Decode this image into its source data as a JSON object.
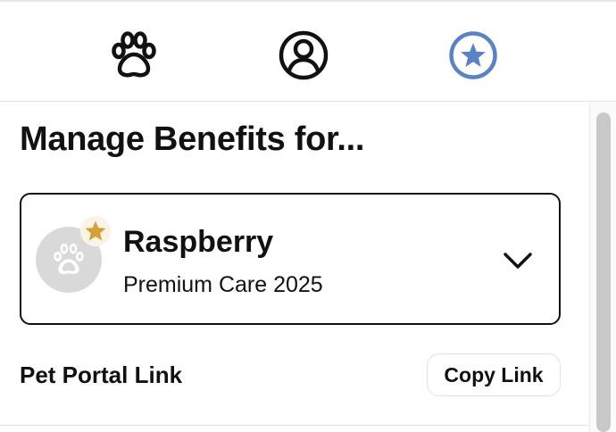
{
  "nav": {
    "items": [
      {
        "icon": "paw-icon",
        "label": "Pets",
        "active": false
      },
      {
        "icon": "account-icon",
        "label": "Account",
        "active": false
      },
      {
        "icon": "star-icon",
        "label": "Benefits",
        "active": true
      }
    ],
    "active_color": "#5b82c4",
    "inactive_color": "#111111"
  },
  "page": {
    "title": "Manage Benefits for..."
  },
  "pet": {
    "name": "Raspberry",
    "plan": "Premium Care 2025",
    "avatar_icon": "paw-icon",
    "badge_icon": "star-icon",
    "badge_color": "#d4a03a"
  },
  "portal": {
    "label": "Pet Portal Link",
    "copy_label": "Copy Link"
  }
}
